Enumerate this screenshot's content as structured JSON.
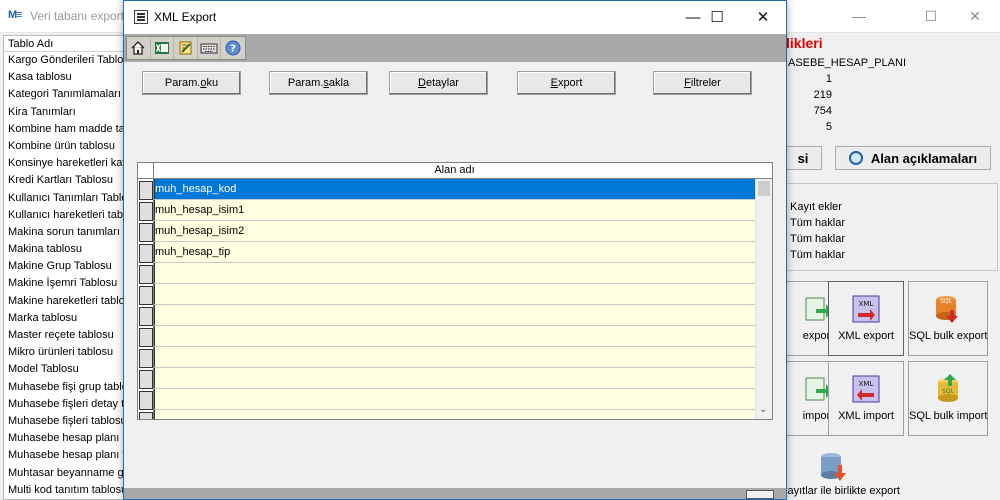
{
  "background_window": {
    "title": "Veri tabanı export-",
    "controls": {
      "minimize": "—",
      "maximize": "☐",
      "close": "✕"
    },
    "table_list": {
      "header": "Tablo Adı",
      "rows": [
        "Kargo Gönderileri Tablos",
        "Kasa tablosu",
        "Kategori Tanımlamaları T",
        "Kira Tanımları",
        "Kombine ham madde tab",
        "Kombine ürün tablosu",
        "Konsinye hareketleri kay",
        "Kredi Kartları Tablosu",
        "Kullanıcı Tanımları Tablos",
        "Kullanıcı hareketleri tablo",
        "Makina sorun tanımları ta",
        "Makina tablosu",
        "Makine Grup Tablosu",
        "Makine İşemri Tablosu",
        "Makine hareketleri tablo",
        "Marka tablosu",
        "Master reçete tablosu",
        "Mikro ürünleri tablosu",
        "Model Tablosu",
        "Muhasebe fişi grup tablo",
        "Muhasebe fişleri detay ta",
        "Muhasebe fişleri tablosu",
        "Muhasebe hesap planı g",
        "Muhasebe hesap planı ta",
        "Muhtasar beyanname g",
        "Multi kod tanıtım tablosu"
      ]
    },
    "right_panel": {
      "info_heading": "likleri",
      "info_rows": [
        "ASEBE_HESAP_PLANI",
        "1",
        "219",
        "754",
        "5"
      ],
      "button_partial": "si",
      "button_field_desc": "Alan açıklamaları",
      "permissions": [
        "Kayıt ekler",
        "Tüm haklar",
        "Tüm haklar",
        "Tüm haklar"
      ],
      "tiles": [
        {
          "label": "export",
          "icon": "export-icon"
        },
        {
          "label": "XML export",
          "icon": "xml-export-icon"
        },
        {
          "label": "SQL bulk export",
          "icon": "sql-bulk-export-icon"
        },
        {
          "label": "import",
          "icon": "import-icon"
        },
        {
          "label": "XML import",
          "icon": "xml-import-icon"
        },
        {
          "label": "SQL bulk import",
          "icon": "sql-bulk-import-icon"
        }
      ],
      "bottom_label": "kayıtlar ile birlikte export"
    }
  },
  "dialog": {
    "title": "XML Export",
    "controls": {
      "minimize": "—",
      "maximize": "☐",
      "close": "✕"
    },
    "toolbar_icons": [
      "home-icon",
      "excel-icon",
      "edit-icon",
      "keyboard-icon",
      "help-icon"
    ],
    "buttons": [
      {
        "pre": "Param.",
        "ul": "o",
        "post": "ku"
      },
      {
        "pre": "Param.",
        "ul": "s",
        "post": "akla"
      },
      {
        "pre": "",
        "ul": "D",
        "post": "etaylar"
      },
      {
        "pre": "",
        "ul": "E",
        "post": "xport"
      },
      {
        "pre": "",
        "ul": "F",
        "post": "iltreler"
      }
    ],
    "grid": {
      "column_header": "Alan adı",
      "rows": [
        "muh_hesap_kod",
        "muh_hesap_isim1",
        "muh_hesap_isim2",
        "muh_hesap_tip",
        "",
        "",
        "",
        "",
        "",
        "",
        "",
        ""
      ],
      "selected_index": 0
    }
  },
  "colors": {
    "selection": "#0078d7",
    "grid_cell_bg": "#ffffe1",
    "heading_red": "#e00000",
    "dialog_border": "#1a6fb8"
  }
}
